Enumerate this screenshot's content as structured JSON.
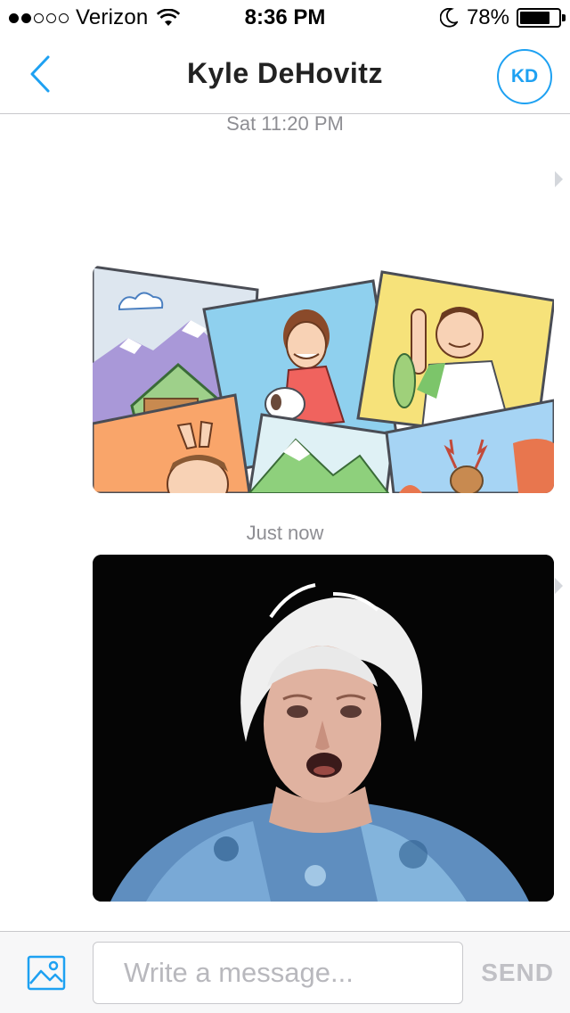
{
  "status_bar": {
    "carrier": "Verizon",
    "signal_bars_filled": 2,
    "signal_bars_total": 5,
    "time": "8:36 PM",
    "battery_percent": "78%",
    "icons": [
      "wifi-icon",
      "moon-icon",
      "battery-icon"
    ]
  },
  "nav": {
    "title": "Kyle DeHovitz",
    "avatar_initials": "KD",
    "back_icon": "chevron-left-icon",
    "accent_color": "#1ea1f2"
  },
  "messages": [
    {
      "timestamp": "Sat 11:20 PM",
      "type": "image",
      "image": "cartoon-photo-collage"
    },
    {
      "timestamp": "Just now",
      "type": "image",
      "image": "elderly-woman-reaction-photo"
    }
  ],
  "composer": {
    "placeholder": "Write a message...",
    "send_label": "SEND",
    "photo_icon": "image-picker-icon"
  }
}
